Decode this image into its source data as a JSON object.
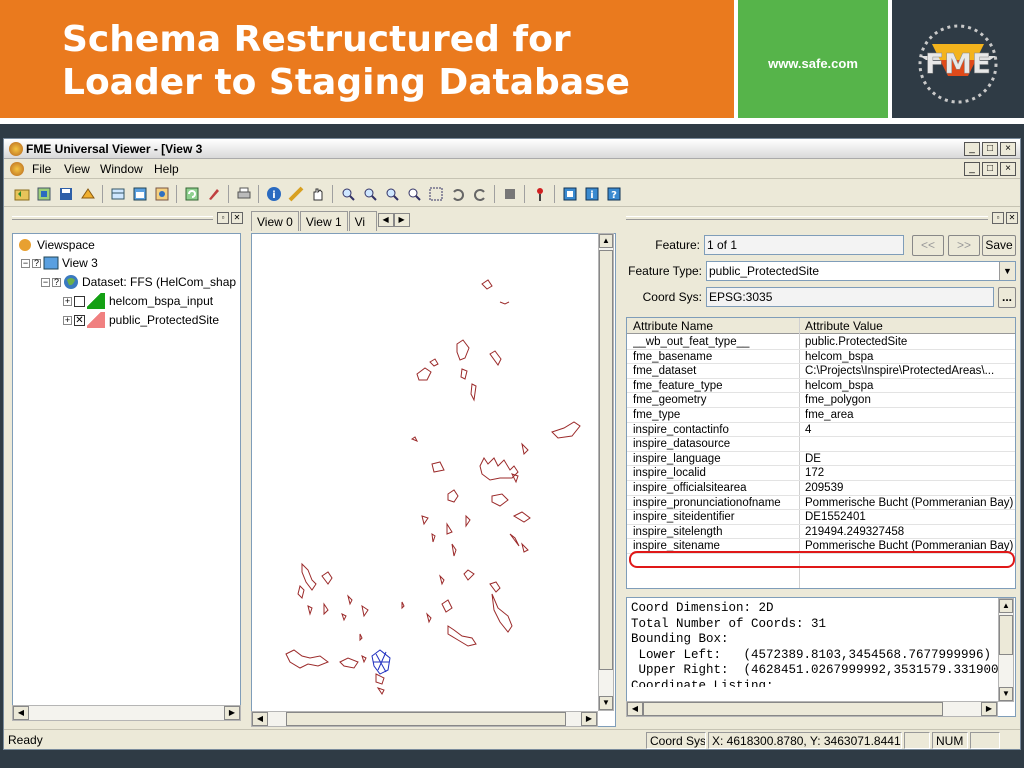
{
  "slide": {
    "title_line1": "Schema Restructured for",
    "title_line2": "Loader to Staging Database",
    "url": "www.safe.com",
    "logo_text": "FME",
    "colors": {
      "orange": "#ea7a1e",
      "green": "#56b44a",
      "dark": "#2f3b45"
    }
  },
  "window": {
    "title": "FME Universal Viewer - [View 3",
    "menu": [
      "File",
      "View",
      "Window",
      "Help"
    ],
    "controls": [
      "_",
      "□",
      "×"
    ]
  },
  "tree": {
    "root": "Viewspace",
    "view": "View 3",
    "dataset": "Dataset: FFS (HelCom_shap",
    "layers": [
      {
        "label": "helcom_bspa_input",
        "checked": false,
        "color": "#14a014"
      },
      {
        "label": "public_ProtectedSite",
        "checked": true,
        "color": "#f08080"
      }
    ]
  },
  "tabs": [
    "View 0",
    "View 1",
    "Vi"
  ],
  "feature": {
    "feature_label": "Feature:",
    "feature_value": "1 of 1",
    "prev_label": "<<",
    "next_label": ">>",
    "save_label": "Save",
    "type_label": "Feature Type:",
    "type_value": "public_ProtectedSite",
    "coordsys_label": "Coord Sys:",
    "coordsys_value": "EPSG:3035",
    "browse_label": "..."
  },
  "attributes": {
    "headers": [
      "Attribute Name",
      "Attribute Value"
    ],
    "rows": [
      {
        "n": "__wb_out_feat_type__",
        "v": "public.ProtectedSite"
      },
      {
        "n": "fme_basename",
        "v": "helcom_bspa"
      },
      {
        "n": "fme_dataset",
        "v": "C:\\Projects\\Inspire\\ProtectedAreas\\..."
      },
      {
        "n": "fme_feature_type",
        "v": "helcom_bspa"
      },
      {
        "n": "fme_geometry",
        "v": "fme_polygon"
      },
      {
        "n": "fme_type",
        "v": "fme_area"
      },
      {
        "n": "inspire_contactinfo",
        "v": "4"
      },
      {
        "n": "inspire_datasource",
        "v": ""
      },
      {
        "n": "inspire_language",
        "v": "DE"
      },
      {
        "n": "inspire_localid",
        "v": "172"
      },
      {
        "n": "inspire_officialsitearea",
        "v": "209539"
      },
      {
        "n": "inspire_pronunciationofname",
        "v": "Pommerische Bucht (Pommeranian Bay)"
      },
      {
        "n": "inspire_siteidentifier",
        "v": "DE1552401"
      },
      {
        "n": "inspire_sitelength",
        "v": "219494.249327458"
      },
      {
        "n": "inspire_sitename",
        "v": "Pommerische Bucht (Pommeranian Bay)"
      }
    ],
    "highlighted": "inspire_sitename"
  },
  "info": {
    "line1": "Coord Dimension: 2D",
    "line2": "Total Number of Coords: 31",
    "line3": "Bounding Box:",
    "line4": " Lower Left:   (4572389.8103,3454568.7677999996)",
    "line5": " Upper Right:  (4628451.0267999992,3531579.331900",
    "line6": "Coordinate Listing:"
  },
  "status": {
    "ready": "Ready",
    "coordsys_label": "Coord Sys",
    "coords": "X: 4618300.8780, Y: 3463071.8441",
    "num": "NUM"
  }
}
